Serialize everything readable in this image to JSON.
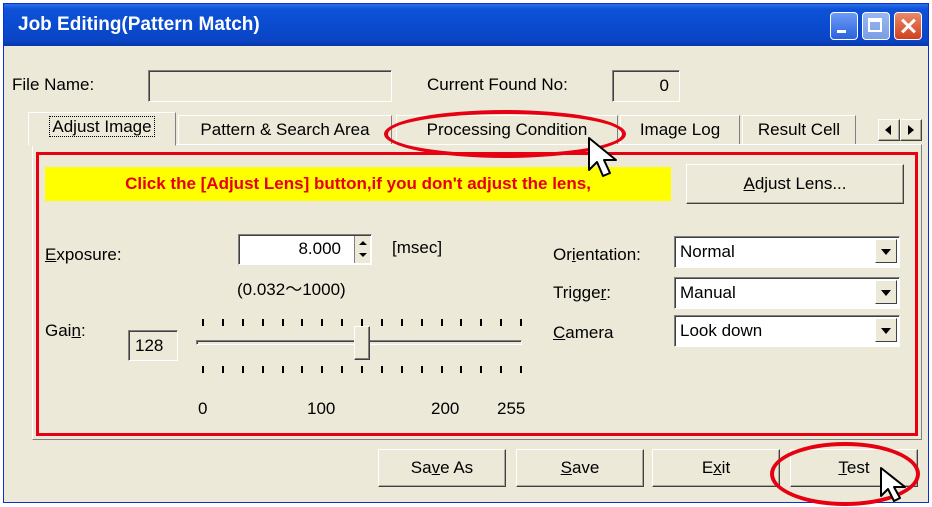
{
  "window": {
    "title": "Job Editing(Pattern Match)"
  },
  "file_name": {
    "label": "File Name:",
    "value": ""
  },
  "current_found": {
    "label": "Current Found No:",
    "value": "0"
  },
  "tabs": [
    {
      "label": "Adjust Image",
      "selected": true
    },
    {
      "label": "Pattern & Search Area"
    },
    {
      "label": "Processing Condition"
    },
    {
      "label": "Image Log"
    },
    {
      "label": "Result Cell"
    }
  ],
  "banner": "Click the [Adjust Lens] button,if you don't adjust the lens,",
  "adjust_lens": {
    "label_pre": "",
    "label_u": "A",
    "label_post": "djust Lens..."
  },
  "exposure": {
    "label_u": "E",
    "label_post": "xposure:",
    "value": "8.000",
    "unit": "[msec]",
    "range": "(0.032～1000)"
  },
  "gain": {
    "label_pre": "Gai",
    "label_u": "n",
    "label_post": ":",
    "value": "128",
    "min": 0,
    "max": 255,
    "level": 128,
    "scale": [
      "0",
      "100",
      "200",
      "255"
    ]
  },
  "orientation": {
    "label_pre": "Or",
    "label_u": "i",
    "label_post": "entation:",
    "value": "Normal"
  },
  "trigger": {
    "label_pre": "Trigge",
    "label_u": "r",
    "label_post": ":",
    "value": "Manual"
  },
  "camera": {
    "label_pre": "",
    "label_u": "C",
    "label_post": "amera",
    "value": "Look down"
  },
  "buttons": {
    "save_as": {
      "pre": "Sa",
      "u": "v",
      "post": "e As"
    },
    "save": {
      "pre": "",
      "u": "S",
      "post": "ave"
    },
    "exit": {
      "pre": "E",
      "u": "x",
      "post": "it"
    },
    "test": {
      "pre": "",
      "u": "T",
      "post": "est"
    }
  },
  "colors": {
    "highlight_red": "#e60012",
    "banner_yellow": "#ffff00",
    "title_blue": "#0a4bd0"
  },
  "icons": [
    "minimize-icon",
    "maximize-icon",
    "close-icon",
    "tab-scroll-left-icon",
    "tab-scroll-right-icon",
    "mouse-cursor-icon"
  ]
}
